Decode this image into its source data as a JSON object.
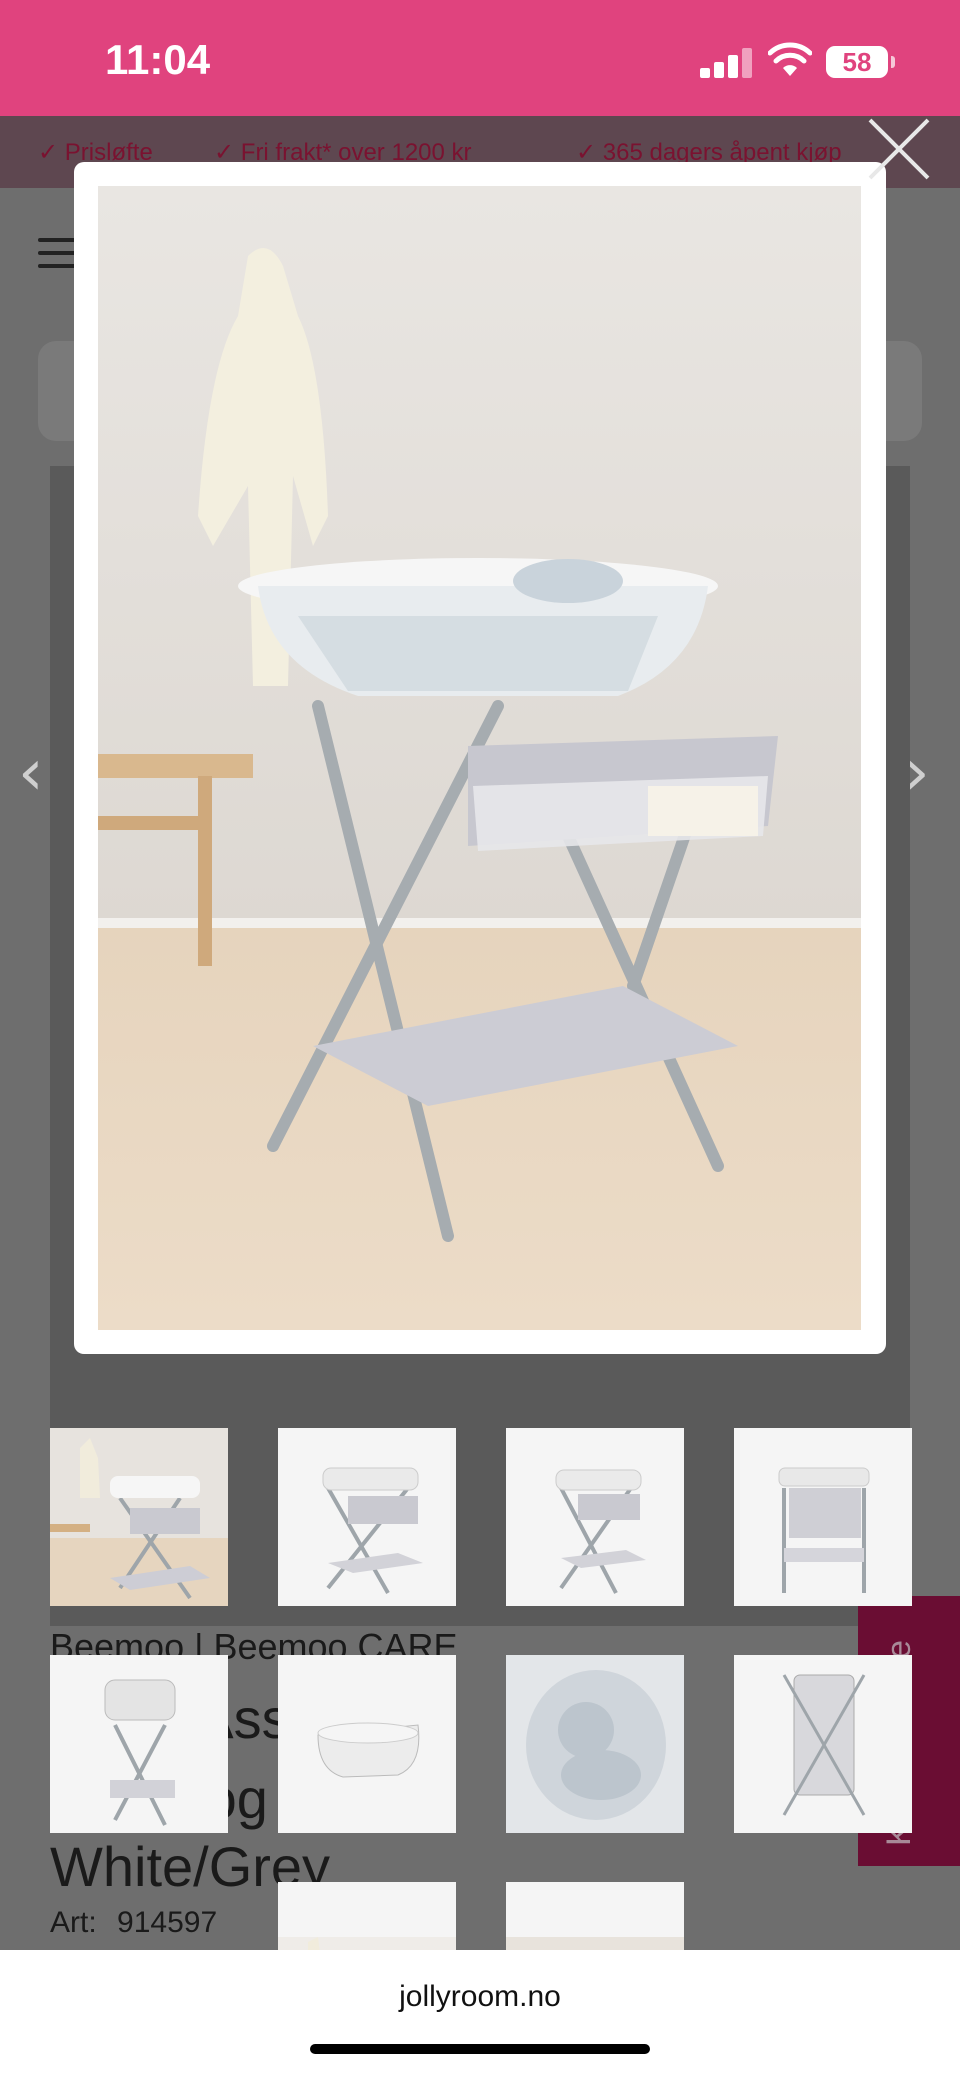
{
  "status_bar": {
    "time": "11:04",
    "battery": "58"
  },
  "promo_bar": {
    "items": [
      "✓ Prisløfte",
      "✓ Fri frakt* over 1200 kr",
      "✓ 365 dagers åpent kjøp"
    ]
  },
  "product": {
    "brand_line": "Beemoo | Beemoo CARE",
    "title_fragment_1": "o C    Ass    eb",
    "title_fragment_2": "de      og",
    "title_line_3": "White/Grey",
    "art_label": "Art:",
    "art_number": "914597"
  },
  "side_tab": {
    "label": "Kundeservice"
  },
  "browser": {
    "url": "jollyroom.no"
  },
  "icons": {
    "close": "close-icon",
    "prev": "chevron-left-icon",
    "next": "chevron-right-icon"
  },
  "thumbnails": {
    "count": 10,
    "selected_index": 0
  }
}
